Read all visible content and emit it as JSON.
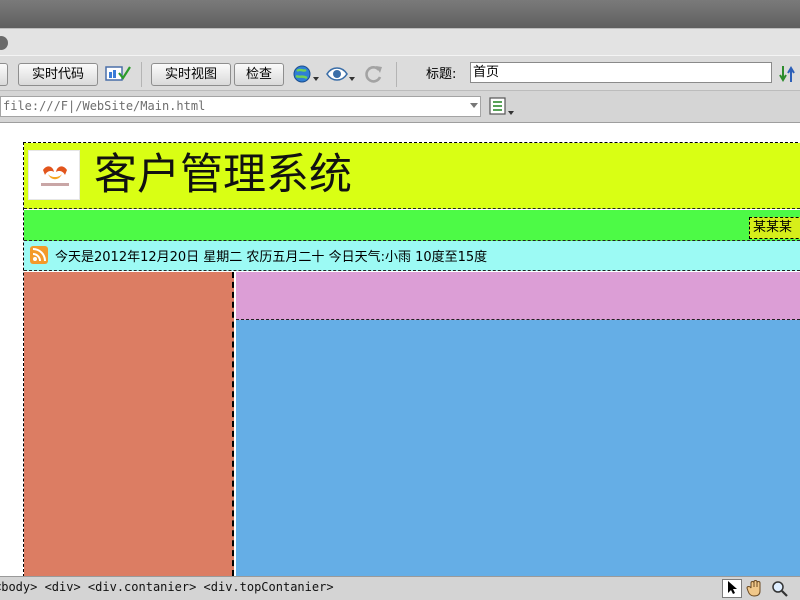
{
  "toolbar": {
    "live_code_label": "实时代码",
    "live_view_label": "实时视图",
    "inspect_label": "检查",
    "title_label": "标题:",
    "title_value": "首页"
  },
  "address": {
    "url": "file:///F|/WebSite/Main.html"
  },
  "page": {
    "site_title": "客户管理系统",
    "nav_user": "某某某",
    "info_text": "今天是2012年12月20日 星期二 农历五月二十 今日天气:小雨 10度至15度"
  },
  "status": {
    "breadcrumb": "<body> <div> <div.contanier> <div.topContanier>"
  },
  "colors": {
    "header": "#d9ff14",
    "nav": "#4dfa46",
    "info": "#9cfaf4",
    "left_column": "#dc7d63",
    "right_band": "#dc9ed6",
    "right_main": "#65aee6"
  }
}
